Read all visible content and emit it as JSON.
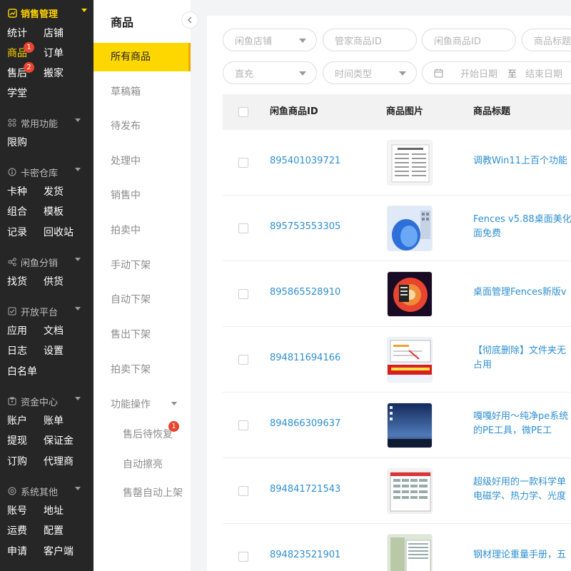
{
  "nav": {
    "groups": [
      {
        "title": "销售管理",
        "icon": "chart-icon",
        "items": [
          [
            "统计",
            "店铺"
          ],
          [
            "商品",
            "订单"
          ],
          [
            "售后",
            "搬家"
          ],
          [
            "学堂"
          ]
        ]
      },
      {
        "title": "常用功能",
        "icon": "grid-icon",
        "items": [
          [
            "限购"
          ]
        ]
      },
      {
        "title": "卡密仓库",
        "icon": "info-icon",
        "items": [
          [
            "卡种",
            "发货"
          ],
          [
            "组合",
            "模板"
          ],
          [
            "记录",
            "回收站"
          ]
        ]
      },
      {
        "title": "闲鱼分销",
        "icon": "share-icon",
        "items": [
          [
            "找货",
            "供货"
          ]
        ]
      },
      {
        "title": "开放平台",
        "icon": "check-square-icon",
        "items": [
          [
            "应用",
            "文档"
          ],
          [
            "日志",
            "设置"
          ],
          [
            "白名单"
          ]
        ]
      },
      {
        "title": "资金中心",
        "icon": "wallet-icon",
        "items": [
          [
            "账户",
            "账单"
          ],
          [
            "提现",
            "保证金"
          ],
          [
            "订购",
            "代理商"
          ]
        ]
      },
      {
        "title": "系统其他",
        "icon": "settings-icon",
        "items": [
          [
            "账号",
            "地址"
          ],
          [
            "运费",
            "配置"
          ],
          [
            "申请",
            "客户端"
          ]
        ]
      }
    ],
    "badges": {
      "goods": "1",
      "aftersale": "2"
    }
  },
  "sub": {
    "title": "商品",
    "items": [
      "所有商品",
      "草稿箱",
      "待发布",
      "处理中",
      "销售中",
      "拍卖中",
      "手动下架",
      "自动下架",
      "售出下架",
      "拍卖下架"
    ],
    "group": "功能操作",
    "children": [
      "售后待恢复",
      "自动擦亮",
      "售罄自动上架"
    ],
    "child_badge": "1"
  },
  "filters": {
    "store": "闲鱼店铺",
    "manager_id": "管家商品ID",
    "xianyu_id": "闲鱼商品ID",
    "title": "商品标题",
    "recharge": "直充",
    "time_type": "时间类型",
    "start_date": "开始日期",
    "to": "至",
    "end_date": "结束日期"
  },
  "table": {
    "headers": {
      "id": "闲鱼商品ID",
      "image": "商品图片",
      "title": "商品标题"
    },
    "rows": [
      {
        "id": "895401039721",
        "title": [
          "调教Win11上百个功能"
        ]
      },
      {
        "id": "895753553305",
        "title": [
          "Fences v5.88桌面美化",
          "面免费"
        ]
      },
      {
        "id": "895865528910",
        "title": [
          "桌面管理Fences新版v"
        ]
      },
      {
        "id": "894811694166",
        "title": [
          "【彻底删除】文件夹无",
          "占用"
        ]
      },
      {
        "id": "894866309637",
        "title": [
          "嘎嘎好用～纯净pe系统",
          "的PE工具，微PE工"
        ]
      },
      {
        "id": "894841721543",
        "title": [
          "超级好用的一款科学单",
          "电磁学、热力学、光度"
        ]
      },
      {
        "id": "894823521901",
        "title": [
          "钢材理论重量手册，五"
        ]
      }
    ]
  },
  "colors": {
    "accent": "#ffd700",
    "link": "#2f8fd1",
    "badge": "#e8442f",
    "nav_bg": "#262626"
  }
}
